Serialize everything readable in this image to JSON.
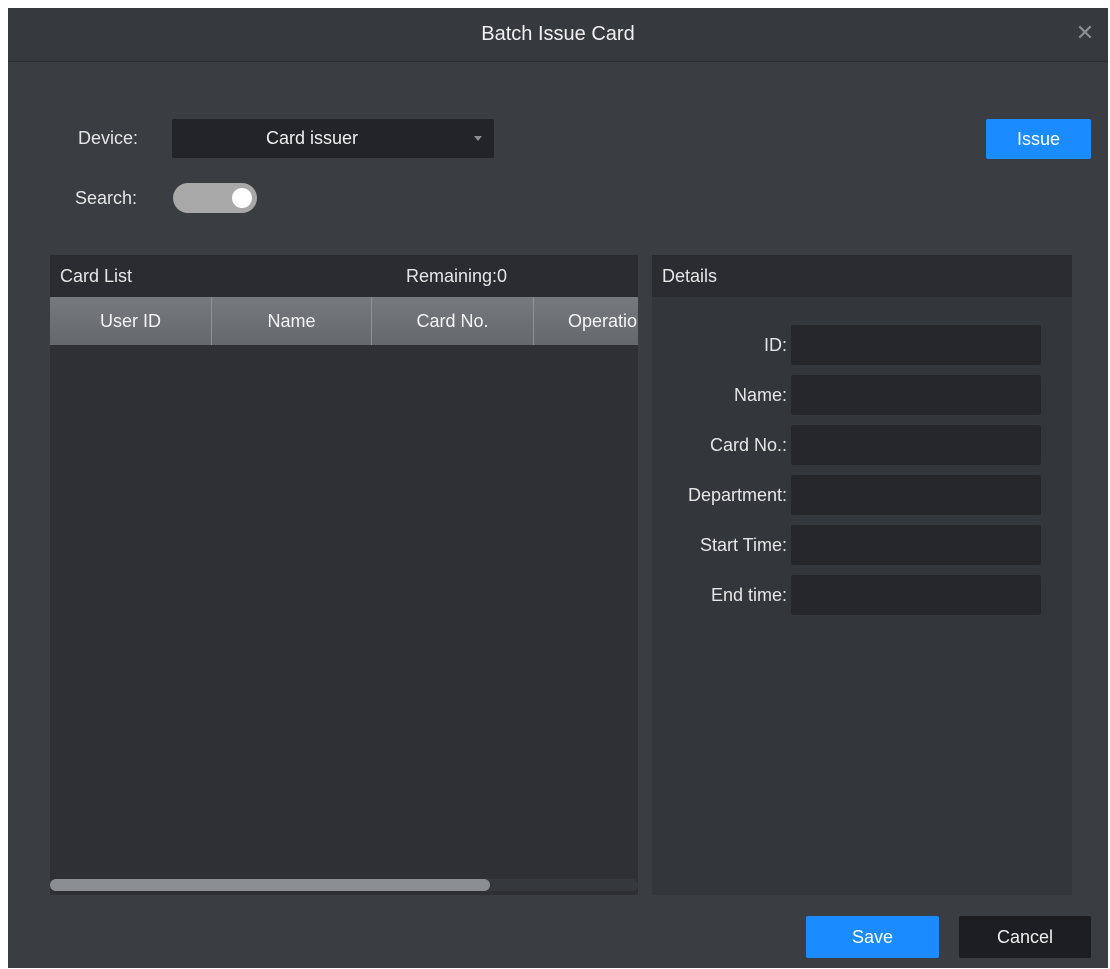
{
  "dialog": {
    "title": "Batch Issue Card"
  },
  "device": {
    "label": "Device:",
    "selected": "Card issuer"
  },
  "search": {
    "label": "Search:",
    "enabled": true
  },
  "buttons": {
    "issue": "Issue",
    "save": "Save",
    "cancel": "Cancel"
  },
  "card_list": {
    "title": "Card List",
    "remaining": "Remaining:0",
    "columns": [
      "User ID",
      "Name",
      "Card No.",
      "Operation"
    ],
    "rows": []
  },
  "details": {
    "title": "Details",
    "fields": [
      {
        "label": "ID:",
        "value": ""
      },
      {
        "label": "Name:",
        "value": ""
      },
      {
        "label": "Card No.:",
        "value": ""
      },
      {
        "label": "Department:",
        "value": ""
      },
      {
        "label": "Start Time:",
        "value": ""
      },
      {
        "label": "End time:",
        "value": ""
      }
    ]
  },
  "colors": {
    "accent": "#1a8cff",
    "background": "#3a3d42",
    "input": "#25272b"
  }
}
